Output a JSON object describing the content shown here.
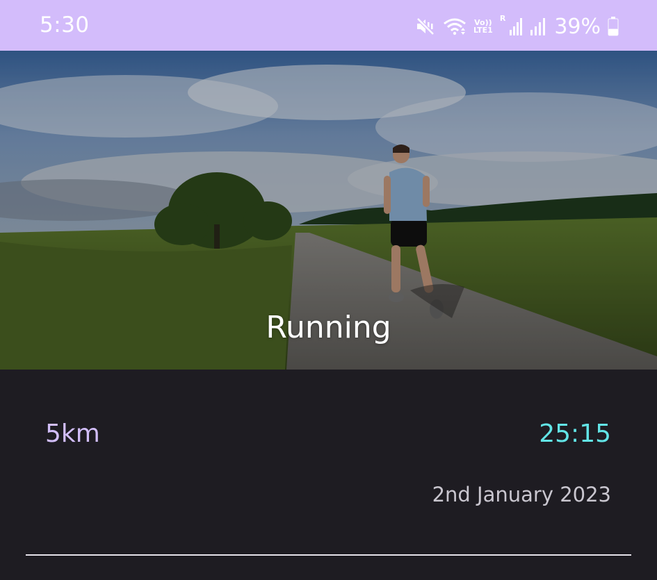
{
  "status_bar": {
    "time": "5:30",
    "network_label_top": "Vo))",
    "network_label_bottom": "LTE1",
    "roaming_label": "R",
    "battery_percent": "39%",
    "battery_level": 0.39,
    "icons": [
      "mute-vibrate-icon",
      "wifi-icon",
      "signal-icon",
      "signal-icon",
      "battery-icon"
    ],
    "background_color": "#d3bcfb"
  },
  "activity": {
    "title": "Running",
    "distance": "5km",
    "duration": "25:15",
    "date": "2nd January 2023",
    "distance_color": "#d2befa",
    "duration_color": "#62e4e6"
  }
}
